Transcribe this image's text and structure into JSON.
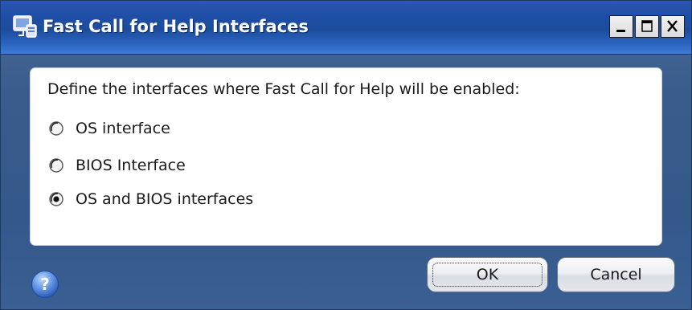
{
  "window": {
    "title": "Fast Call for Help Interfaces",
    "controls": [
      "minimize",
      "maximize",
      "close"
    ]
  },
  "panel": {
    "prompt": "Define the interfaces where Fast Call for Help will be enabled:",
    "options": [
      {
        "label": "OS interface",
        "selected": false
      },
      {
        "label": "BIOS Interface",
        "selected": false
      },
      {
        "label": "OS and BIOS interfaces",
        "selected": true
      }
    ]
  },
  "footer": {
    "ok_label": "OK",
    "cancel_label": "Cancel",
    "help_icon": "help-question-icon"
  },
  "colors": {
    "titlebar": "#1f4ea6",
    "frame": "#3a5c8c",
    "panel_bg": "#ffffff"
  }
}
